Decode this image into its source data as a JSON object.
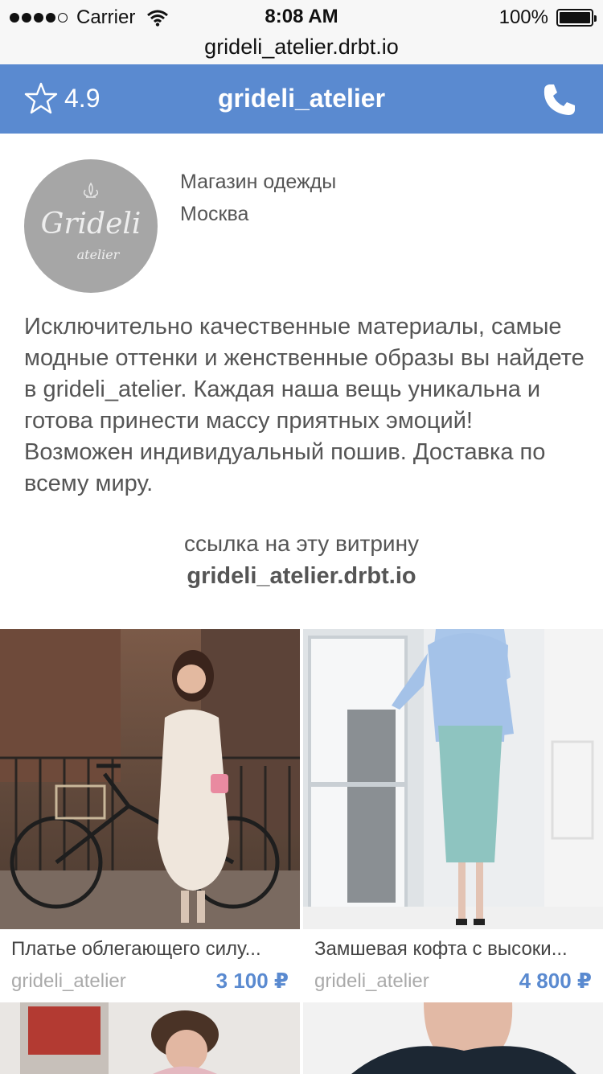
{
  "status_bar": {
    "carrier": "Carrier",
    "time": "8:08 AM",
    "battery": "100%"
  },
  "url_bar": {
    "url": "grideli_atelier.drbt.io"
  },
  "header": {
    "rating": "4.9",
    "title": "grideli_atelier",
    "rating_icon": "star-outline-icon",
    "call_icon": "phone-icon"
  },
  "profile": {
    "avatar_title": "Grideli",
    "avatar_subtitle": "atelier",
    "category": "Магазин одежды",
    "city": "Москва"
  },
  "description": "Исключительно качественные материалы, самые модные оттенки и женственные образы вы найдете в grideli_atelier. Каждая наша вещь уникальна и готова принести массу приятных эмоций! Возможен индивидуальный пошив. Доставка по всему миру.",
  "link": {
    "caption": "ссылка на эту витрину",
    "url": "grideli_atelier.drbt.io"
  },
  "colors": {
    "accent": "#5a8ad0",
    "text": "#555555",
    "muted": "#aaaaaa"
  },
  "products": [
    {
      "title": "Платье облегающего силу...",
      "shop": "grideli_atelier",
      "price": "3 100 ₽"
    },
    {
      "title": "Замшевая кофта с высоки...",
      "shop": "grideli_atelier",
      "price": "4 800 ₽"
    }
  ]
}
